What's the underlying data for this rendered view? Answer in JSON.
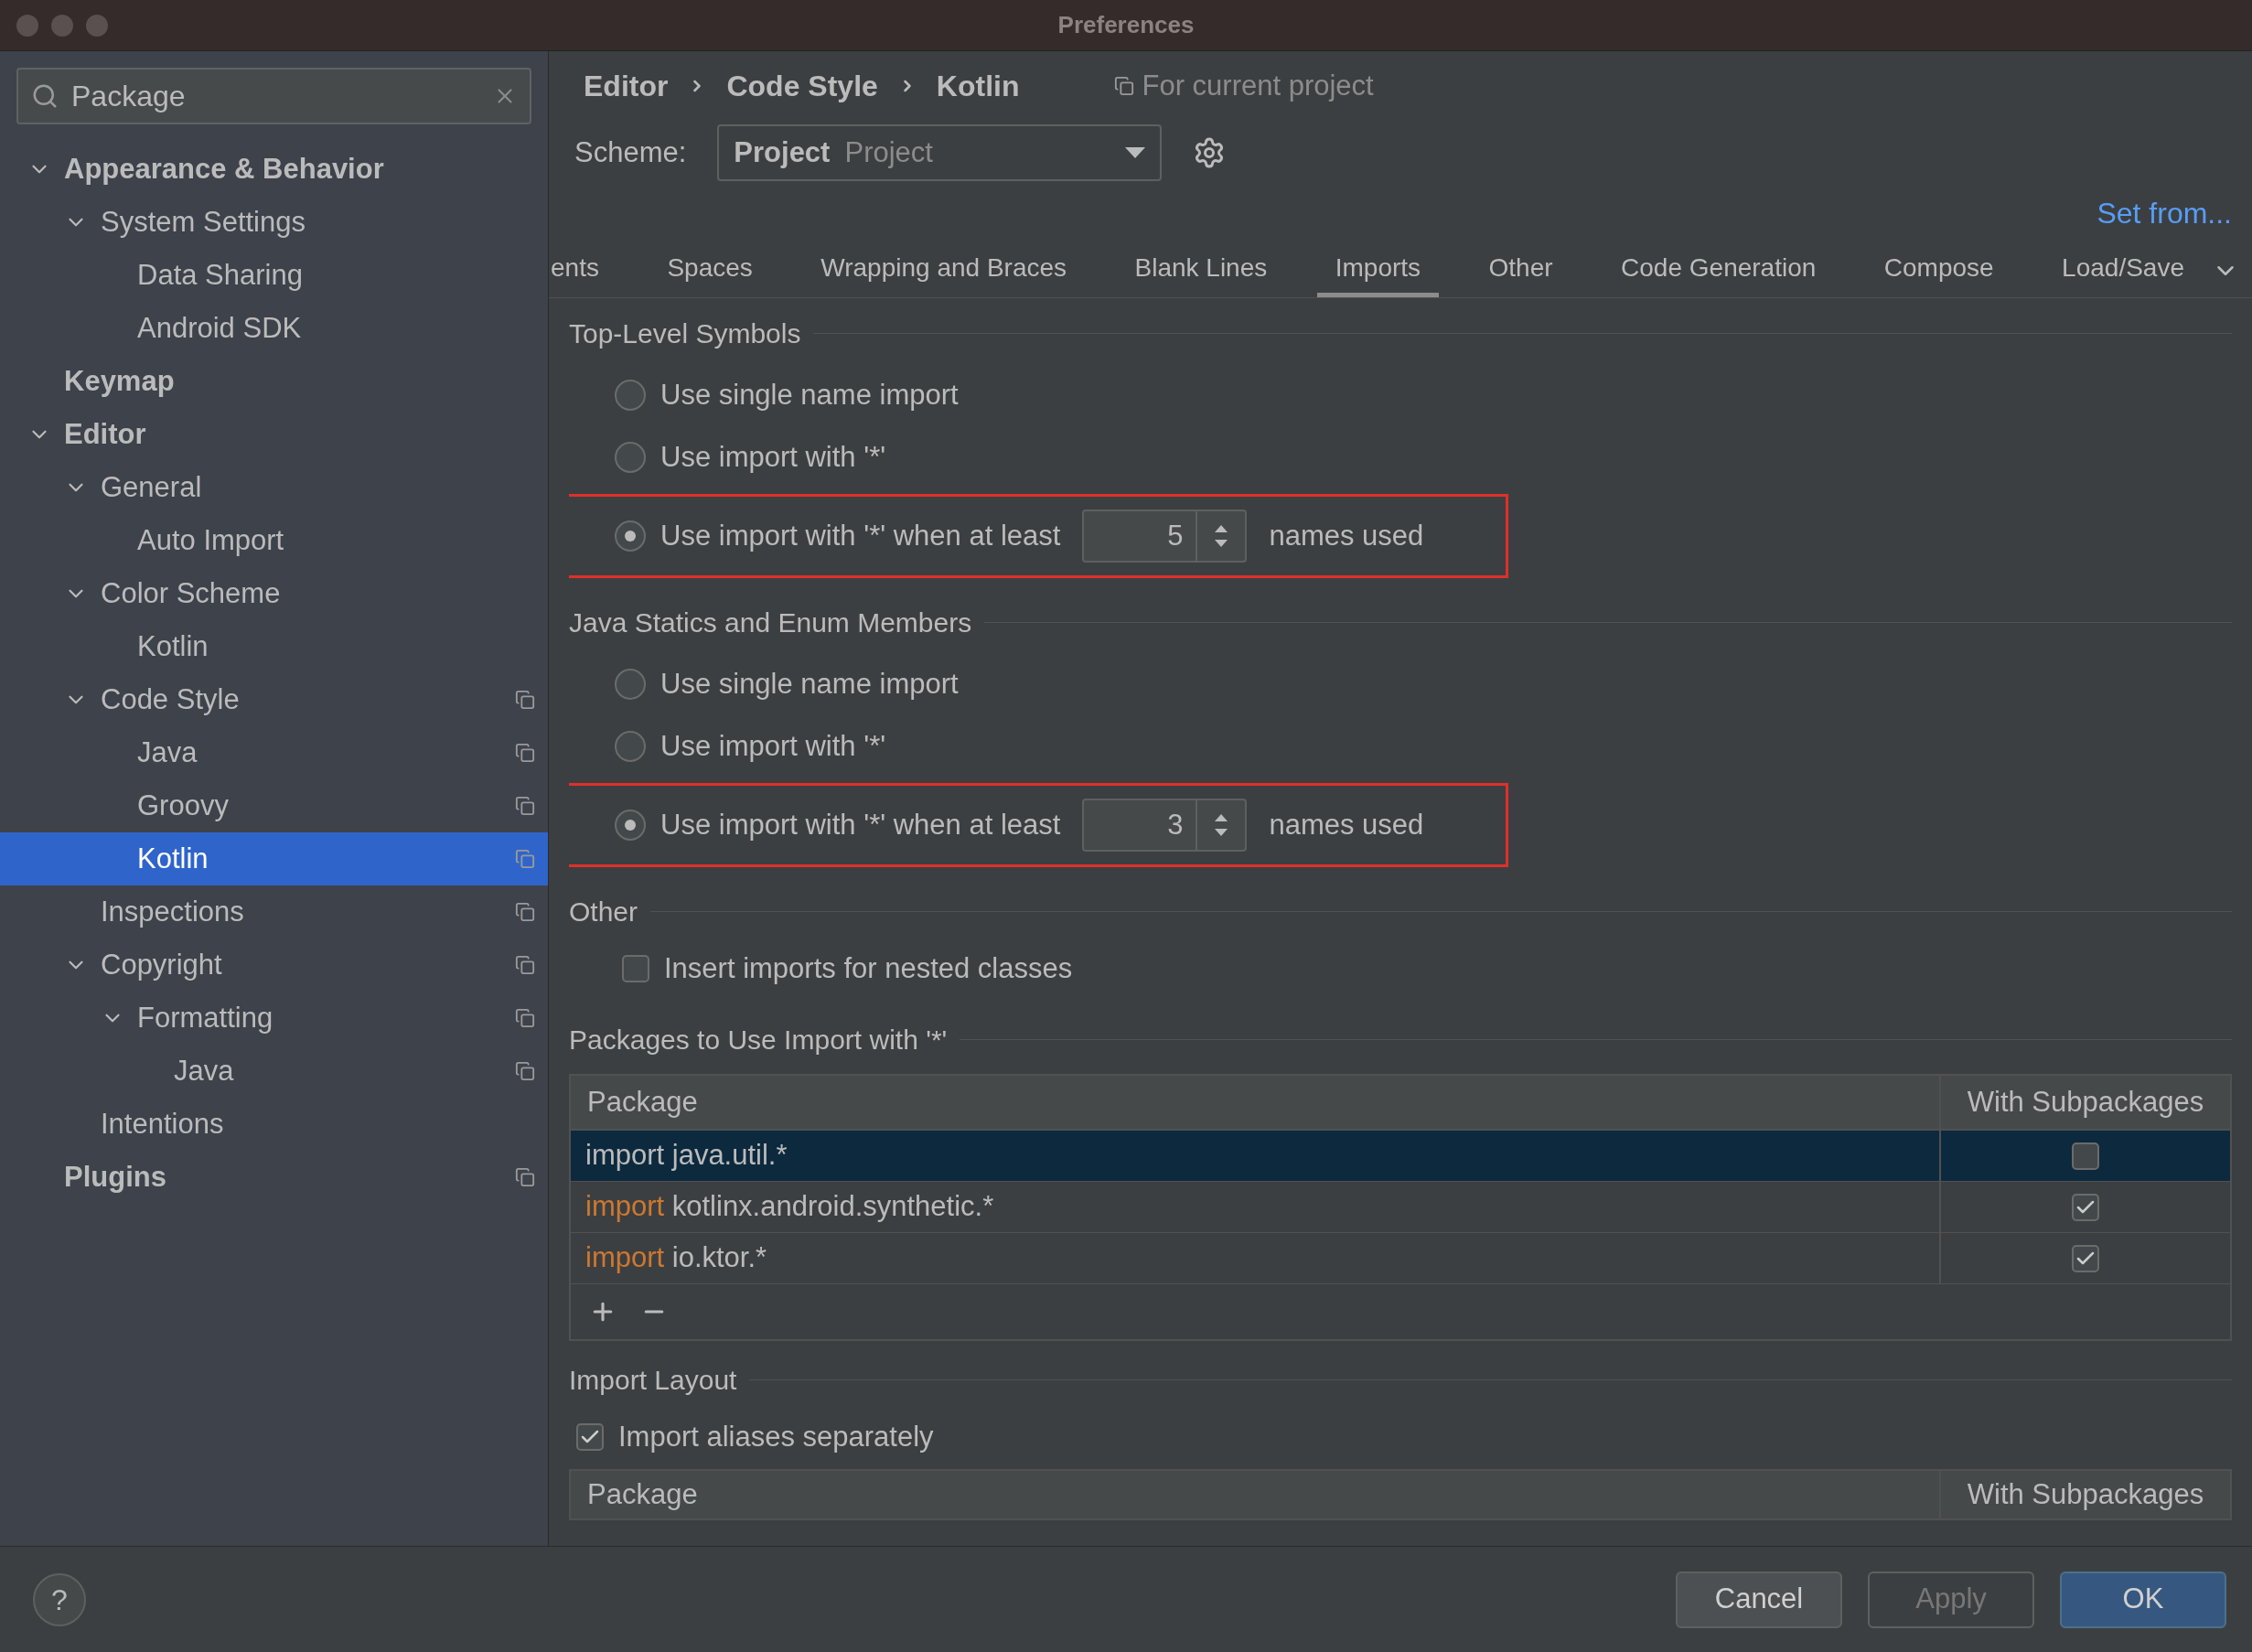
{
  "window": {
    "title": "Preferences"
  },
  "sidebar": {
    "search": {
      "value": "Package"
    },
    "items": [
      {
        "label": "Appearance & Behavior",
        "expanded": true,
        "project_level": false,
        "selected": false,
        "children": [
          {
            "label": "System Settings",
            "expanded": true,
            "project_level": false,
            "selected": false,
            "children": [
              {
                "label": "Data Sharing",
                "project_level": false,
                "selected": false
              },
              {
                "label": "Android SDK",
                "project_level": false,
                "selected": false
              }
            ]
          }
        ]
      },
      {
        "label": "Keymap",
        "project_level": false,
        "selected": false
      },
      {
        "label": "Editor",
        "expanded": true,
        "project_level": false,
        "selected": false,
        "children": [
          {
            "label": "General",
            "expanded": true,
            "project_level": false,
            "selected": false,
            "children": [
              {
                "label": "Auto Import",
                "project_level": false,
                "selected": false
              }
            ]
          },
          {
            "label": "Color Scheme",
            "expanded": true,
            "project_level": false,
            "selected": false,
            "children": [
              {
                "label": "Kotlin",
                "project_level": false,
                "selected": false
              }
            ]
          },
          {
            "label": "Code Style",
            "expanded": true,
            "project_level": true,
            "selected": false,
            "children": [
              {
                "label": "Java",
                "project_level": true,
                "selected": false
              },
              {
                "label": "Groovy",
                "project_level": true,
                "selected": false
              },
              {
                "label": "Kotlin",
                "project_level": true,
                "selected": true
              }
            ]
          },
          {
            "label": "Inspections",
            "project_level": true,
            "selected": false
          },
          {
            "label": "Copyright",
            "expanded": true,
            "project_level": true,
            "selected": false,
            "children": [
              {
                "label": "Formatting",
                "expanded": true,
                "project_level": true,
                "selected": false,
                "children": [
                  {
                    "label": "Java",
                    "project_level": true,
                    "selected": false
                  }
                ]
              }
            ]
          },
          {
            "label": "Intentions",
            "project_level": false,
            "selected": false
          }
        ]
      },
      {
        "label": "Plugins",
        "project_level": true,
        "selected": false
      }
    ]
  },
  "breadcrumb": [
    "Editor",
    "Code Style",
    "Kotlin"
  ],
  "scope_note": "For current project",
  "scheme": {
    "label": "Scheme:",
    "value_bold": "Project",
    "value": "Project"
  },
  "set_from_link": "Set from...",
  "tabs": [
    {
      "label": "ents",
      "selected": false
    },
    {
      "label": "Spaces",
      "selected": false
    },
    {
      "label": "Wrapping and Braces",
      "selected": false
    },
    {
      "label": "Blank Lines",
      "selected": false
    },
    {
      "label": "Imports",
      "selected": true
    },
    {
      "label": "Other",
      "selected": false
    },
    {
      "label": "Code Generation",
      "selected": false
    },
    {
      "label": "Compose",
      "selected": false
    },
    {
      "label": "Load/Save",
      "selected": false
    }
  ],
  "sections": [
    {
      "kind": "radio_group",
      "title": "Top-Level Symbols",
      "options": [
        {
          "label": "Use single name import",
          "selected": false,
          "highlighted": false
        },
        {
          "label": "Use import with '*'",
          "selected": false,
          "highlighted": false
        },
        {
          "label": "Use import with '*' when at least",
          "selected": true,
          "highlighted": true,
          "count": "5",
          "suffix": "names used"
        }
      ]
    },
    {
      "kind": "radio_group",
      "title": "Java Statics and Enum Members",
      "options": [
        {
          "label": "Use single name import",
          "selected": false,
          "highlighted": false
        },
        {
          "label": "Use import with '*'",
          "selected": false,
          "highlighted": false
        },
        {
          "label": "Use import with '*' when at least",
          "selected": true,
          "highlighted": true,
          "count": "3",
          "suffix": "names used"
        }
      ]
    },
    {
      "kind": "checkbox",
      "title": "Other",
      "checkbox": {
        "label": "Insert imports for nested classes",
        "checked": false
      }
    },
    {
      "kind": "table",
      "title": "Packages to Use Import with '*'",
      "columns": [
        "Package",
        "With Subpackages"
      ],
      "rows": [
        {
          "keyword": "import",
          "name": "java.util.*",
          "checked": false,
          "selected": true
        },
        {
          "keyword": "import",
          "name": "kotlinx.android.synthetic.*",
          "checked": true,
          "selected": false
        },
        {
          "keyword": "import",
          "name": "io.ktor.*",
          "checked": true,
          "selected": false
        }
      ]
    },
    {
      "kind": "layout",
      "title": "Import Layout",
      "checkbox": {
        "label": "Import aliases separately",
        "checked": true
      },
      "columns": [
        "Package",
        "With Subpackages"
      ]
    }
  ],
  "footer": {
    "help": "?",
    "buttons": [
      {
        "label": "Cancel",
        "kind": "normal",
        "disabled": false
      },
      {
        "label": "Apply",
        "kind": "normal",
        "disabled": true
      },
      {
        "label": "OK",
        "kind": "default",
        "disabled": false
      }
    ]
  }
}
